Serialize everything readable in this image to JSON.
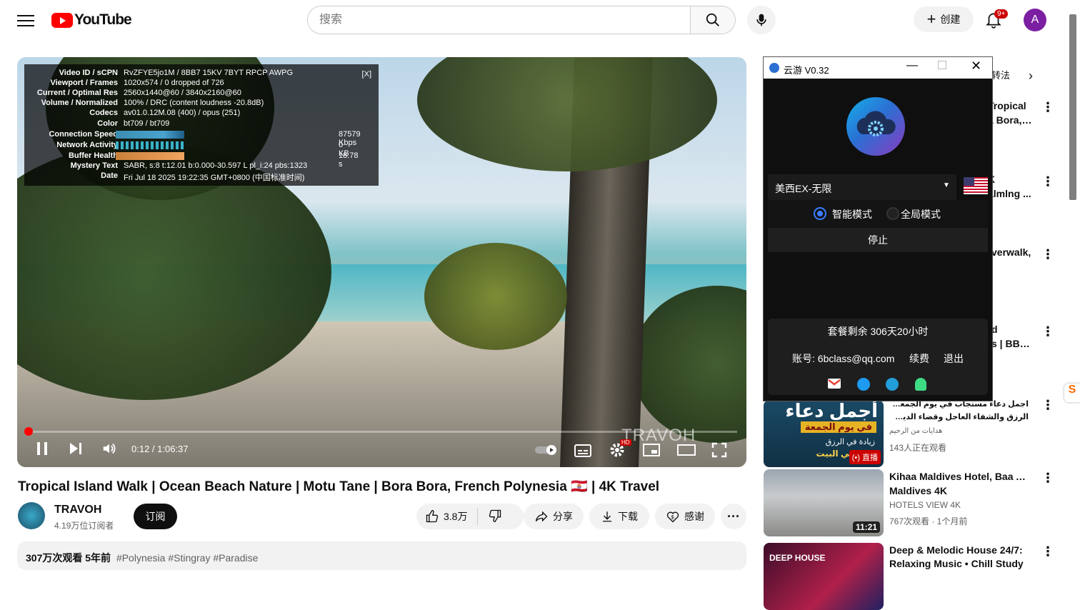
{
  "header": {
    "logo_text": "YouTube",
    "search_placeholder": "搜索",
    "create_label": "创建",
    "notif_badge": "9+",
    "avatar_letter": "A"
  },
  "stats": {
    "close": "[X]",
    "rows": [
      {
        "label": "Video ID / sCPN",
        "value": "RvZFYE5jo1M  /  8BB7 15KV 7BYT RPCP AWPG"
      },
      {
        "label": "Viewport / Frames",
        "value": "1020x574 / 0 dropped of 726"
      },
      {
        "label": "Current / Optimal Res",
        "value": "2560x1440@60 / 3840x2160@60"
      },
      {
        "label": "Volume / Normalized",
        "value": "100% / DRC (content loudness -20.8dB)"
      },
      {
        "label": "Codecs",
        "value": "av01.0.12M.08 (400) / opus (251)"
      },
      {
        "label": "Color",
        "value": "bt709 / bt709"
      },
      {
        "label": "Connection Speed",
        "value": "87579 Kbps"
      },
      {
        "label": "Network Activity",
        "value": "0 KB"
      },
      {
        "label": "Buffer Health",
        "value": "18.78 s"
      },
      {
        "label": "Mystery Text",
        "value": "SABR, s:8 t:12.01 b:0.000-30.597 L pl_i:24 pbs:1323"
      },
      {
        "label": "Date",
        "value": "Fri Jul 18 2025 19:22:35 GMT+0800 (中国标准时间)"
      }
    ]
  },
  "player": {
    "time": "0:12 / 1:06:37",
    "watermark": "TRAVOH",
    "hd_badge": "HD",
    "progress_fraction": 0.003
  },
  "video": {
    "title": "Tropical Island Walk | Ocean Beach Nature | Motu Tane | Bora Bora, French Polynesia 🇵🇫 | 4K Travel",
    "channel": "TRAVOH",
    "subs": "4.19万位订阅者",
    "subscribe": "订阅",
    "likes": "3.8万",
    "share": "分享",
    "download": "下载",
    "thanks": "感谢",
    "views_date": "307万次观看  5年前",
    "tags": "#Polynesia #Stingray #Paradise"
  },
  "sidebar": {
    "chip_partial": "转法",
    "items": [
      {
        "title": "Tropical",
        "title2": "a Bora, ...",
        "sub": ""
      },
      {
        "title": "K",
        "title2": "almlng ...",
        "sub": ""
      },
      {
        "title": "verwalk,",
        "title2": "",
        "sub": ""
      },
      {
        "title": "d",
        "title2": "s | BBC ...",
        "sub": ""
      },
      {
        "title": "اجمل دعاء مستجاب في يوم الجمعة لجلب",
        "title2": "الرزق والشفاء العاجل وقضاء الدين بأذن الله",
        "sub": "هدايات من الرحيم",
        "sub2": "143人正在观看",
        "live_badge": "直播",
        "thumb_text1": "أجمل دعاء",
        "thumb_text2": "في يوم الجمعة",
        "thumb_text3": "زيادة في الرزق",
        "thumb_text4": "في البيت"
      },
      {
        "title": "Kihaa Maldives Hotel, Baa Atoll",
        "title2": "Maldives 4K",
        "sub": "HOTELS VIEW 4K",
        "sub2": "767次观看 · 1个月前",
        "duration": "11:21"
      },
      {
        "title": "Deep & Melodic House 24/7:",
        "title2": "Relaxing Music • Chill Study",
        "thumb_text1": "DEEP HOUSE"
      }
    ]
  },
  "popup": {
    "title": "云游 V0.32",
    "server": "美西EX-无限",
    "mode_smart": "智能模式",
    "mode_global": "全局模式",
    "stop": "停止",
    "remain": "套餐剩余 306天20小时",
    "account": "账号: 6bclass@qq.com",
    "renew": "续费",
    "logout": "退出"
  }
}
